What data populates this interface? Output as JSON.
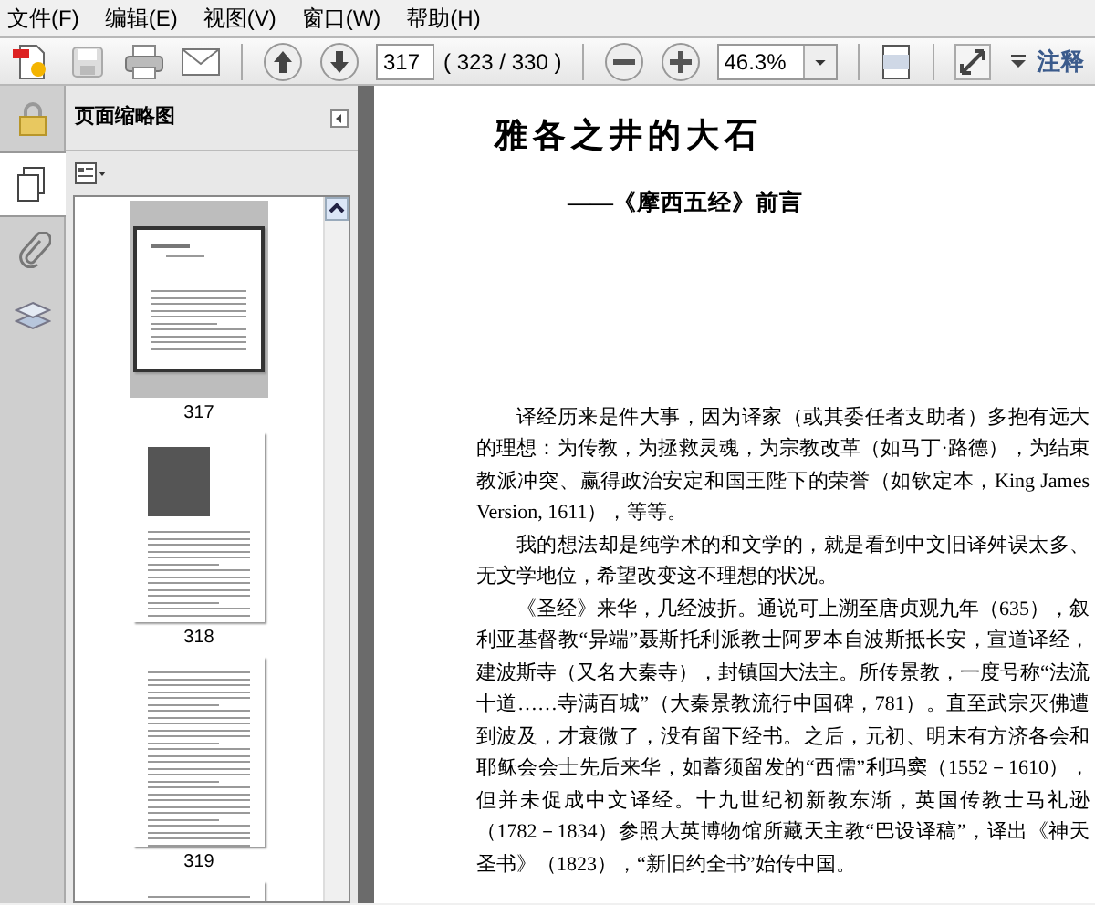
{
  "menu": [
    {
      "label": "文件(F)"
    },
    {
      "label": "编辑(E)"
    },
    {
      "label": "视图(V)"
    },
    {
      "label": "窗口(W)"
    },
    {
      "label": "帮助(H)"
    }
  ],
  "toolbar": {
    "page_number": "317",
    "page_count": "( 323 / 330 )",
    "zoom": "46.3%",
    "comment_label": "注释"
  },
  "sidebar": {
    "title": "页面缩略图",
    "tabs": [
      {
        "kind": "pages",
        "selected": true
      },
      {
        "kind": "attachments",
        "selected": false
      },
      {
        "kind": "layers",
        "selected": false
      }
    ],
    "thumbnails": [
      {
        "kind": "text",
        "label": "317",
        "selected": true
      },
      {
        "kind": "picture",
        "label": "318",
        "selected": false
      },
      {
        "kind": "text",
        "label": "319",
        "selected": false
      },
      {
        "kind": "text",
        "selected": false
      }
    ]
  },
  "document": {
    "title": "雅各之井的大石",
    "subtitle": "——《摩西五经》前言",
    "paragraphs": [
      "译经历来是件大事，因为译家（或其委任者支助者）多抱有远大的理想：为传教，为拯救灵魂，为宗教改革（如马丁·路德），为结束教派冲突、赢得政治安定和国王陛下的荣誉（如钦定本，King James Version, 1611），等等。",
      "我的想法却是纯学术的和文学的，就是看到中文旧译舛误太多、无文学地位，希望改变这不理想的状况。",
      "《圣经》来华，几经波折。通说可上溯至唐贞观九年（635），叙利亚基督教“异端”聂斯托利派教士阿罗本自波斯抵长安，宣道译经，建波斯寺（又名大秦寺），封镇国大法主。所传景教，一度号称“法流十道……寺满百城”（大秦景教流行中国碑，781）。直至武宗灭佛遭到波及，才衰微了，没有留下经书。之后，元初、明末有方济各会和耶稣会会士先后来华，如蓄须留发的“西儒”利玛窦（1552－1610），但并未促成中文译经。十九世纪初新教东渐，英国传教士马礼逊（1782－1834）参照大英博物馆所藏天主教“巴设译稿”，译出《神天圣书》（1823），“新旧约全书”始传中国。"
    ]
  }
}
